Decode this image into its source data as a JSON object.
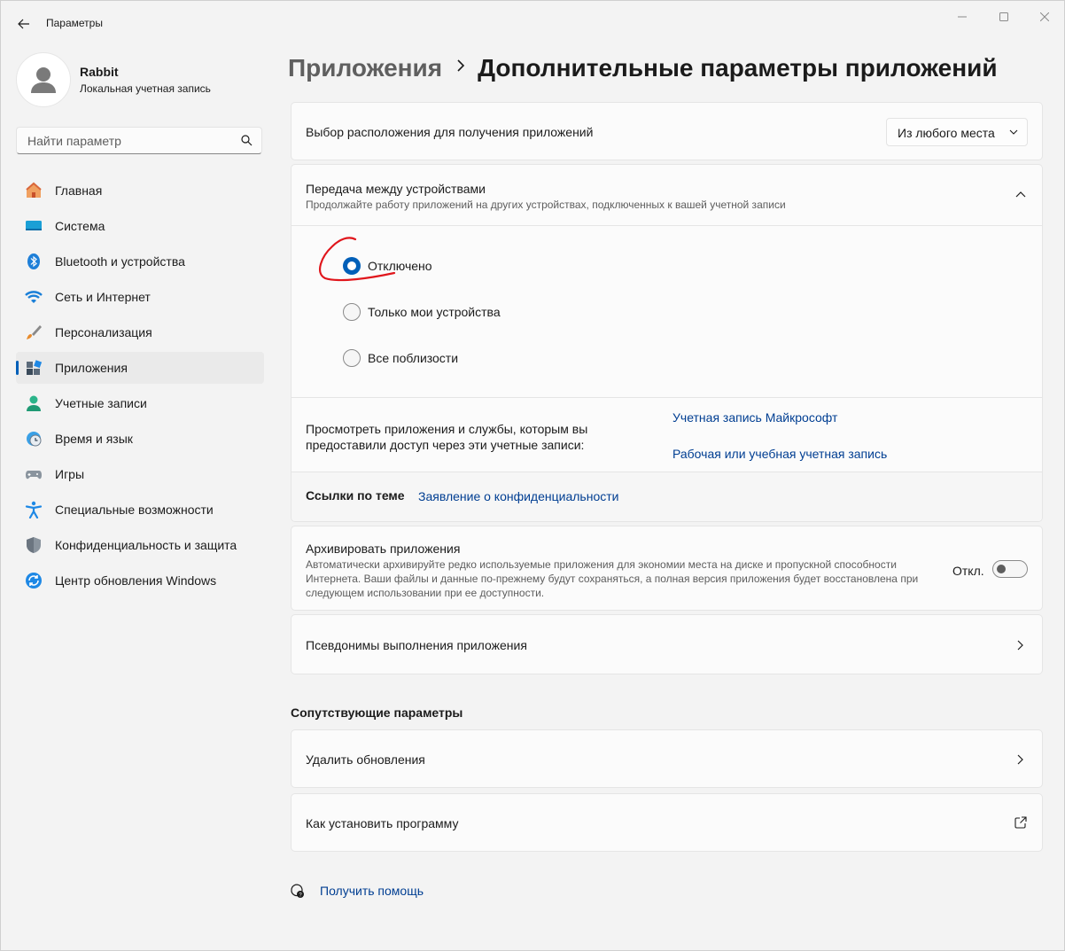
{
  "window": {
    "title": "Параметры"
  },
  "profile": {
    "name": "Rabbit",
    "account_type": "Локальная учетная запись"
  },
  "search": {
    "placeholder": "Найти параметр"
  },
  "sidebar": {
    "items": [
      {
        "label": "Главная",
        "icon": "home-icon"
      },
      {
        "label": "Система",
        "icon": "system-icon"
      },
      {
        "label": "Bluetooth и устройства",
        "icon": "bluetooth-icon"
      },
      {
        "label": "Сеть и Интернет",
        "icon": "wifi-icon"
      },
      {
        "label": "Персонализация",
        "icon": "brush-icon"
      },
      {
        "label": "Приложения",
        "icon": "apps-icon",
        "active": true
      },
      {
        "label": "Учетные записи",
        "icon": "person-icon"
      },
      {
        "label": "Время и язык",
        "icon": "clock-globe-icon"
      },
      {
        "label": "Игры",
        "icon": "gamepad-icon"
      },
      {
        "label": "Специальные возможности",
        "icon": "accessibility-icon"
      },
      {
        "label": "Конфиденциальность и защита",
        "icon": "shield-icon"
      },
      {
        "label": "Центр обновления Windows",
        "icon": "update-icon"
      }
    ]
  },
  "breadcrumb": {
    "parent": "Приложения",
    "current": "Дополнительные параметры приложений"
  },
  "app_source": {
    "label": "Выбор расположения для получения приложений",
    "selected": "Из любого места"
  },
  "share_across_devices": {
    "title": "Передача между устройствами",
    "description": "Продолжайте работу приложений на других устройствах, подключенных к вашей учетной записи",
    "options": [
      {
        "label": "Отключено",
        "selected": true
      },
      {
        "label": "Только мои устройства",
        "selected": false
      },
      {
        "label": "Все поблизости",
        "selected": false
      }
    ],
    "accounts_text": "Просмотреть приложения и службы, которым вы предоставили доступ через эти учетные записи:",
    "account_links": [
      "Учетная запись Майкрософт",
      "Рабочая или учебная учетная запись"
    ],
    "related_links_label": "Ссылки по теме",
    "privacy_link": "Заявление о конфиденциальности"
  },
  "archive_apps": {
    "title": "Архивировать приложения",
    "description": "Автоматически архивируйте редко используемые приложения для экономии места на диске и пропускной способности Интернета. Ваши файлы и данные по-прежнему будут сохраняться, а полная версия приложения будет восстановлена при следующем использовании при ее доступности.",
    "state_label": "Откл.",
    "enabled": false
  },
  "app_execution_aliases": {
    "label": "Псевдонимы выполнения приложения"
  },
  "related_settings": {
    "title": "Сопутствующие параметры",
    "items": [
      {
        "label": "Удалить обновления",
        "icon": "chevron-right-icon"
      },
      {
        "label": "Как установить программу",
        "icon": "open-external-icon"
      }
    ]
  },
  "help": {
    "label": "Получить помощь"
  },
  "colors": {
    "accent": "#005fb8",
    "link": "#003e92",
    "annotation": "#e0161c"
  }
}
